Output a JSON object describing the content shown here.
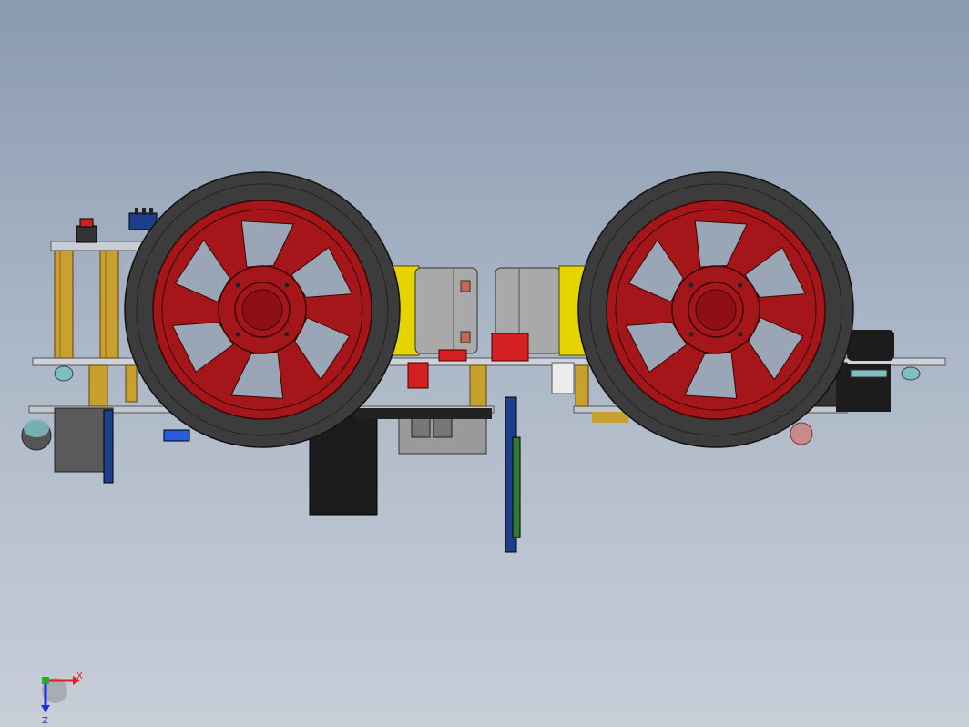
{
  "viewport": {
    "background_top": "#8a9ab0",
    "background_bottom": "#c8ced8"
  },
  "model": {
    "wheel_rim_color": "#a5161a",
    "tire_color": "#3c3c3c",
    "motor_color": "#e6d400",
    "motor_housing_color": "#a9a9a9",
    "standoff_color": "#c8a030",
    "pcb_color": "#1d3f8a",
    "battery_color": "#1c1c1c"
  },
  "triad": {
    "x_label": "X",
    "z_label": "Z",
    "x_color": "#e02020",
    "y_color": "#20b020",
    "z_color": "#2030d0"
  }
}
